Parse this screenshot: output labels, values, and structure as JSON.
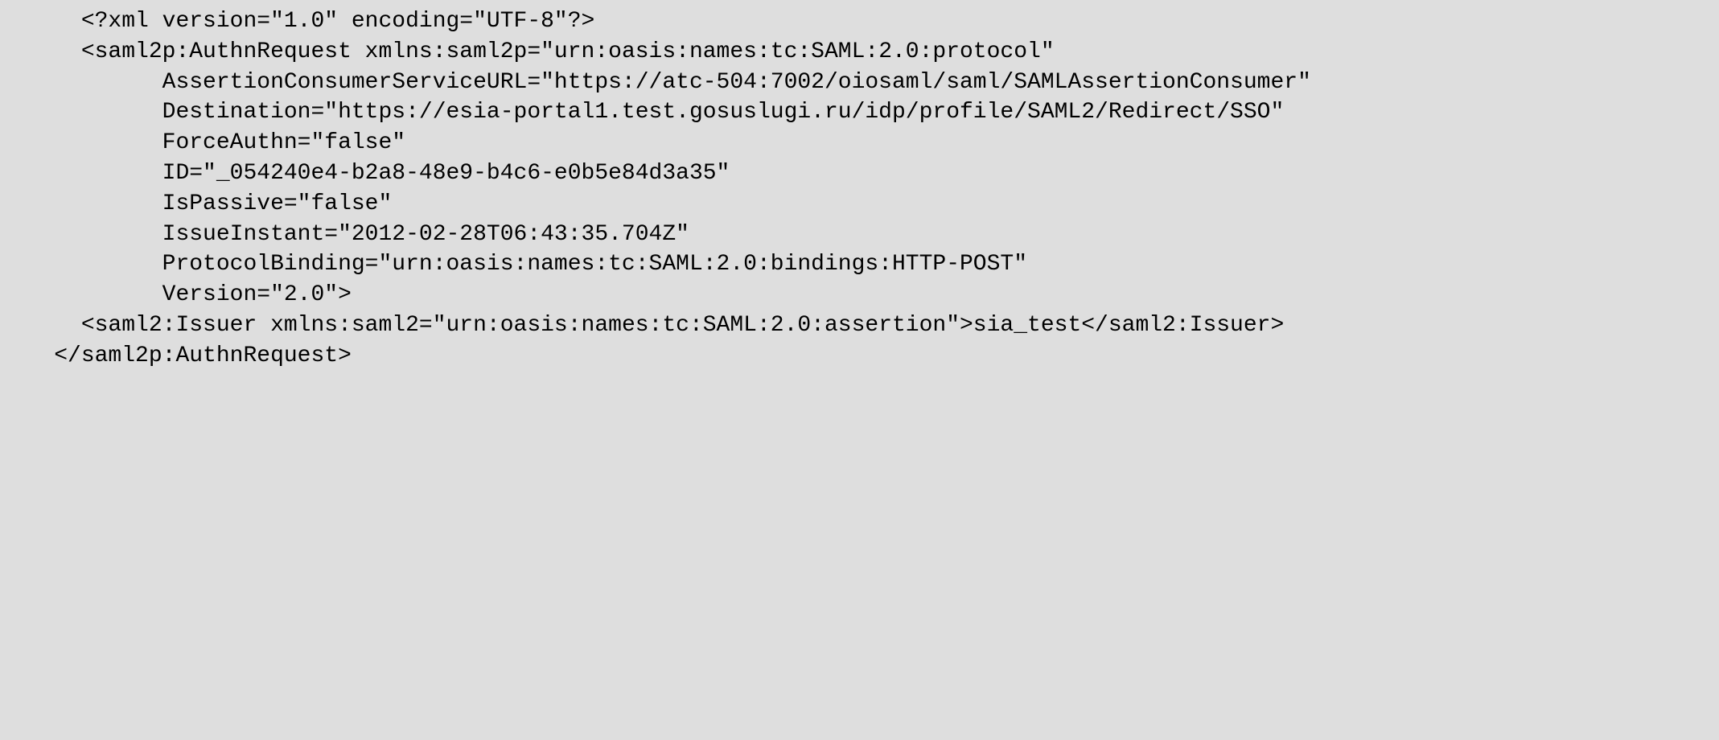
{
  "code": {
    "line1": "      <?xml version=\"1.0\" encoding=\"UTF-8\"?>",
    "line2": "      <saml2p:AuthnRequest xmlns:saml2p=\"urn:oasis:names:tc:SAML:2.0:protocol\"",
    "line3": "            AssertionConsumerServiceURL=\"https://atc-504:7002/oiosaml/saml/SAMLAssertionConsumer\"",
    "line4": "            Destination=\"https://esia-portal1.test.gosuslugi.ru/idp/profile/SAML2/Redirect/SSO\"",
    "line5": "            ForceAuthn=\"false\"",
    "line6": "            ID=\"_054240e4-b2a8-48e9-b4c6-e0b5e84d3a35\"",
    "line7": "            IsPassive=\"false\"",
    "line8": "            IssueInstant=\"2012-02-28T06:43:35.704Z\"",
    "line9": "            ProtocolBinding=\"urn:oasis:names:tc:SAML:2.0:bindings:HTTP-POST\"",
    "line10": "            Version=\"2.0\">",
    "line11": "      <saml2:Issuer xmlns:saml2=\"urn:oasis:names:tc:SAML:2.0:assertion\">sia_test</saml2:Issuer>",
    "line12": "    </saml2p:AuthnRequest>"
  }
}
